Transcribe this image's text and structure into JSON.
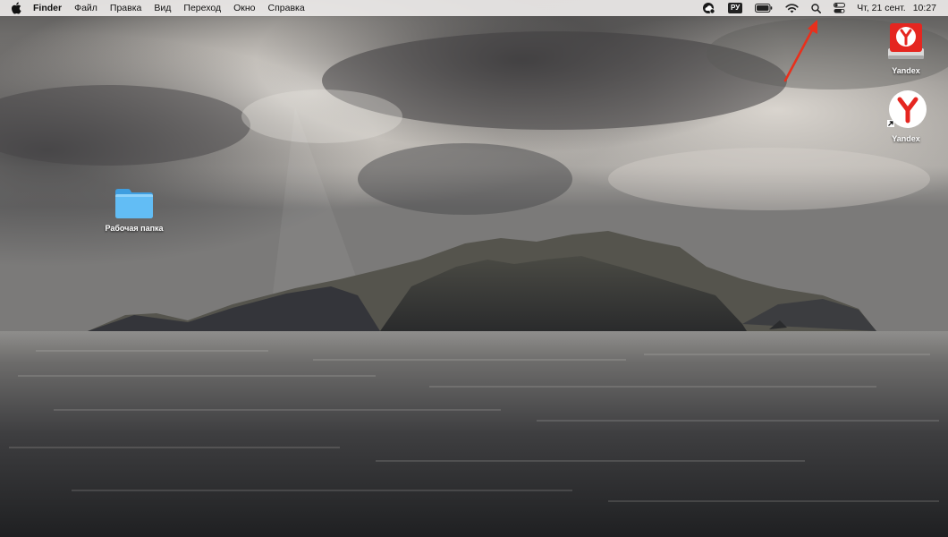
{
  "menubar": {
    "app_name": "Finder",
    "menus": [
      "Файл",
      "Правка",
      "Вид",
      "Переход",
      "Окно",
      "Справка"
    ],
    "input_source": "РУ",
    "clock_date": "Чт, 21 сент.",
    "clock_time": "10:27"
  },
  "desktop": {
    "folder_label": "Рабочая папка",
    "disk_label": "Yandex",
    "app_label": "Yandex"
  },
  "colors": {
    "menubar_bg": "#ECEAE8",
    "folder_blue": "#5AB4F0",
    "yandex_red": "#E52620",
    "annotation_red": "#E8301C"
  },
  "icons": [
    "apple-logo-icon",
    "creative-cloud-icon",
    "battery-icon",
    "wifi-icon",
    "spotlight-search-icon",
    "control-center-icon",
    "folder-icon",
    "yandex-disk-image-icon",
    "yandex-browser-icon",
    "alias-arrow-icon",
    "annotation-arrow"
  ]
}
